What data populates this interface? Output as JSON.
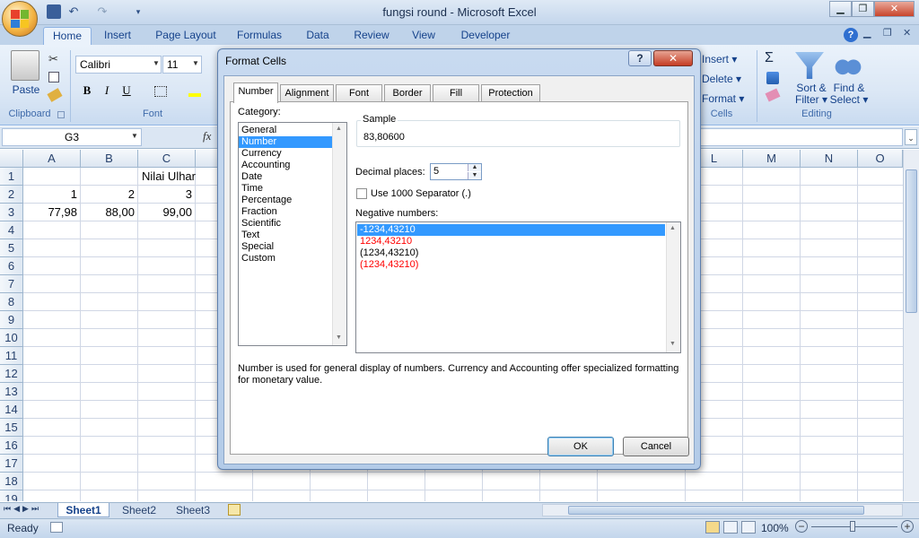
{
  "window": {
    "title": "fungsi round - Microsoft Excel"
  },
  "ribbon_tabs": [
    "Home",
    "Insert",
    "Page Layout",
    "Formulas",
    "Data",
    "Review",
    "View",
    "Developer"
  ],
  "clipboard": {
    "paste": "Paste",
    "group": "Clipboard"
  },
  "font": {
    "name": "Calibri",
    "size": "11",
    "group": "Font"
  },
  "cells_group": {
    "insert": "Insert",
    "delete": "Delete",
    "format": "Format",
    "group": "Cells"
  },
  "editing": {
    "sort": "Sort &",
    "filter": "Filter",
    "find": "Find &",
    "select": "Select",
    "group": "Editing"
  },
  "formula_bar": {
    "name_box": "G3",
    "fx": "fx"
  },
  "columns": [
    "A",
    "B",
    "C",
    "L",
    "M",
    "N",
    "O"
  ],
  "rows": [
    "1",
    "2",
    "3",
    "4",
    "5",
    "6",
    "7",
    "8",
    "9",
    "10",
    "11",
    "12",
    "13",
    "14",
    "15",
    "16",
    "17",
    "18",
    "19"
  ],
  "cells": {
    "title": "Nilai Ulhar",
    "r2": [
      "1",
      "2",
      "3"
    ],
    "r3": [
      "77,98",
      "88,00",
      "99,00"
    ]
  },
  "sheets": [
    "Sheet1",
    "Sheet2",
    "Sheet3"
  ],
  "status": {
    "ready": "Ready",
    "zoom": "100%"
  },
  "dialog": {
    "title": "Format Cells",
    "tabs": [
      "Number",
      "Alignment",
      "Font",
      "Border",
      "Fill",
      "Protection"
    ],
    "category_label": "Category:",
    "categories": [
      "General",
      "Number",
      "Currency",
      "Accounting",
      "Date",
      "Time",
      "Percentage",
      "Fraction",
      "Scientific",
      "Text",
      "Special",
      "Custom"
    ],
    "selected_category": "Number",
    "sample_label": "Sample",
    "sample_value": "83,80600",
    "decimal_label": "Decimal places:",
    "decimal_value": "5",
    "separator_label": "Use 1000 Separator (.)",
    "separator_checked": false,
    "negative_label": "Negative numbers:",
    "negative_options": [
      {
        "text": "-1234,43210",
        "color": "#000000",
        "selected": true
      },
      {
        "text": "1234,43210",
        "color": "#ff0000",
        "selected": false
      },
      {
        "text": "(1234,43210)",
        "color": "#000000",
        "selected": false
      },
      {
        "text": "(1234,43210)",
        "color": "#ff0000",
        "selected": false
      }
    ],
    "description": "Number is used for general display of numbers.  Currency and Accounting offer specialized formatting for monetary value.",
    "ok": "OK",
    "cancel": "Cancel",
    "help": "?",
    "close": "✕"
  },
  "colors": {
    "accent": "#15428b",
    "selection": "#3399ff",
    "negative_red": "#ff0000"
  }
}
